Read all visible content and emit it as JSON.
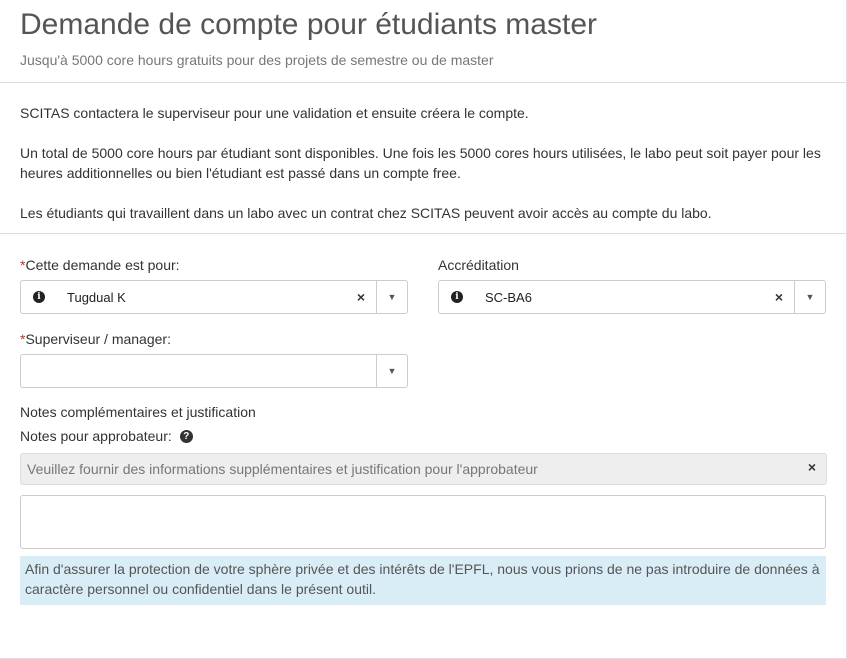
{
  "page": {
    "title": "Demande de compte pour étudiants master",
    "subtitle": "Jusqu'à 5000 core hours gratuits pour des projets de semestre ou de master"
  },
  "info": {
    "p1": "SCITAS contactera le superviseur pour une validation et ensuite créera le compte.",
    "p2": "Un total de 5000 core hours par étudiant sont disponibles. Une fois les 5000 cores hours utilisées, le labo peut soit payer pour les heures additionnelles ou bien l'étudiant est passé dans un compte free.",
    "p3": "Les étudiants qui travaillent dans un labo avec un contrat chez SCITAS peuvent avoir accès au compte du labo."
  },
  "form": {
    "requested_for": {
      "label": "Cette demande est pour:",
      "value": "Tugdual K",
      "required": true
    },
    "accreditation": {
      "label": "Accréditation",
      "value": "SC-BA6"
    },
    "supervisor": {
      "label": "Superviseur / manager:",
      "value": "",
      "required": true
    },
    "notes_section": "Notes complémentaires et justification",
    "notes_label": "Notes pour approbateur:",
    "notes_placeholder": "Veuillez fournir des informations supplémentaires et justification pour l'approbateur",
    "notes_value": "",
    "privacy_notice": "Afin d'assurer la protection de votre sphère privée et des intérêts de l'EPFL, nous vous prions de ne pas introduire de données à caractère personnel ou confidentiel dans le présent outil."
  },
  "glyphs": {
    "required": "*",
    "clear": "×",
    "caret": "▼",
    "info": "i",
    "help": "?"
  }
}
